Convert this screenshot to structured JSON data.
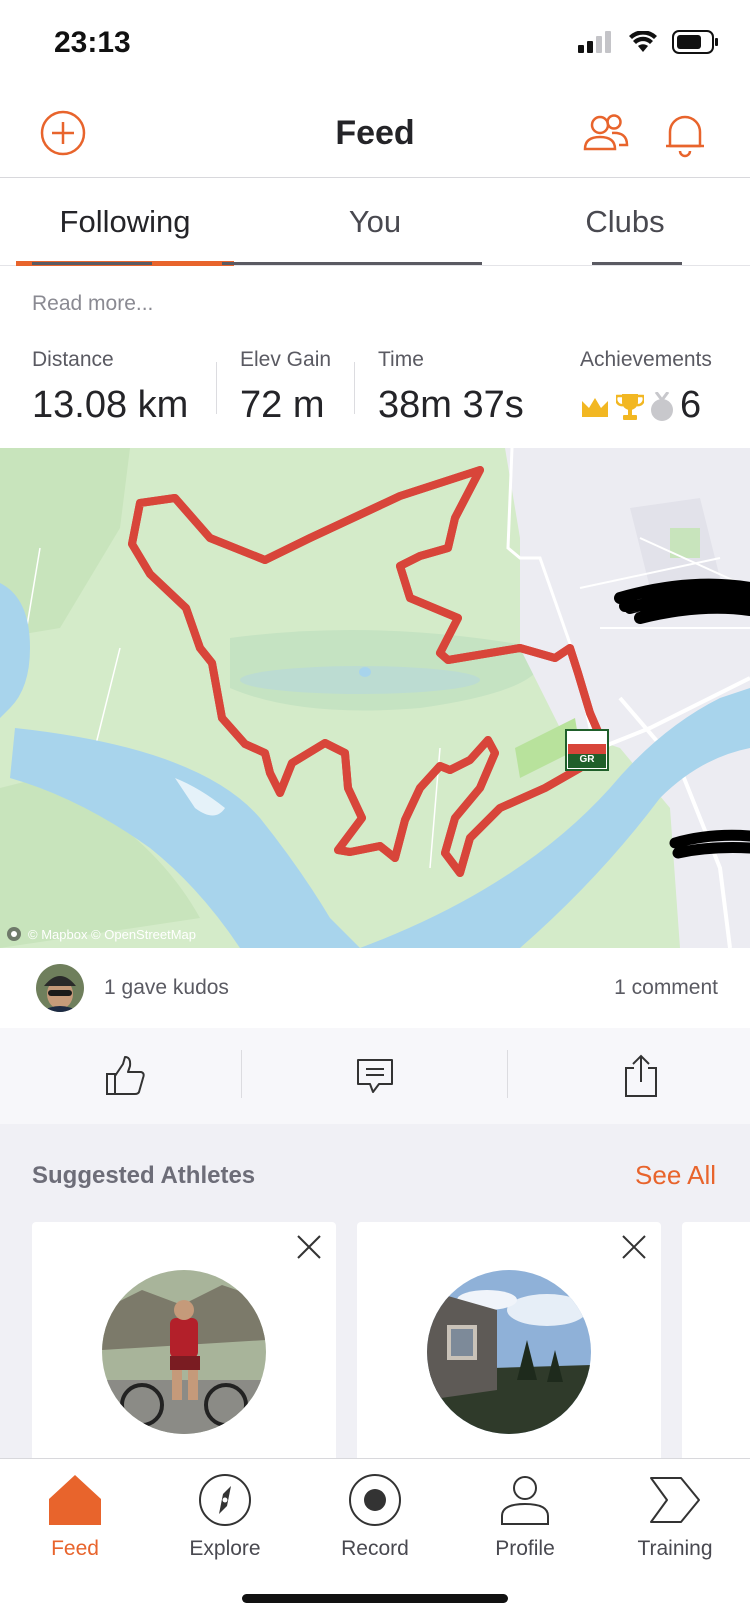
{
  "status_bar": {
    "time": "23:13"
  },
  "header": {
    "title": "Feed",
    "icons": [
      "add-icon",
      "people-icon",
      "bell-icon"
    ]
  },
  "tabs": [
    {
      "label": "Following",
      "active": true
    },
    {
      "label": "You",
      "active": false
    },
    {
      "label": "Clubs",
      "active": false
    }
  ],
  "activity": {
    "read_more": "Read more...",
    "stats": {
      "distance": {
        "label": "Distance",
        "value": "13.08 km"
      },
      "elev_gain": {
        "label": "Elev Gain",
        "value": "72 m"
      },
      "time": {
        "label": "Time",
        "value": "38m 37s"
      },
      "achievements": {
        "label": "Achievements",
        "value": "6",
        "icons": [
          "crown-icon",
          "trophy-icon",
          "medal-icon"
        ]
      }
    },
    "map_attribution": "© Mapbox © OpenStreetMap",
    "map_badge": "GR",
    "kudos_text": "1 gave kudos",
    "comment_text": "1 comment"
  },
  "suggested": {
    "title": "Suggested Athletes",
    "see_all": "See All"
  },
  "bottom_nav": [
    {
      "label": "Feed",
      "active": true
    },
    {
      "label": "Explore",
      "active": false
    },
    {
      "label": "Record",
      "active": false
    },
    {
      "label": "Profile",
      "active": false
    },
    {
      "label": "Training",
      "active": false
    }
  ],
  "colors": {
    "accent": "#e8642c",
    "text": "#242428",
    "muted": "#5a5a62",
    "map_green": "#cfe8c6",
    "water": "#a8d4ec",
    "route": "#d8453a"
  }
}
